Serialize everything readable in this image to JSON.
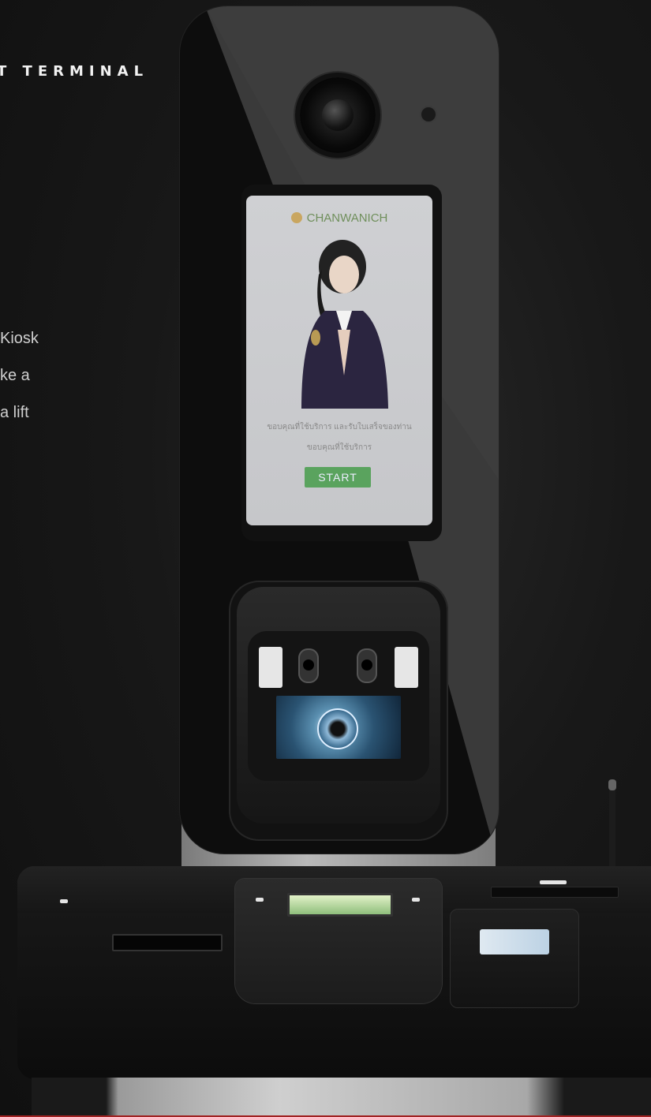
{
  "heading": "T TERMINAL",
  "description_lines": [
    "Kiosk",
    "ke a",
    "a lift"
  ],
  "kiosk_screen": {
    "brand": "CHANWANICH",
    "line1": "ขอบคุณที่ใช้บริการ และรับใบเสร็จของท่าน",
    "line2": "ขอบคุณที่ใช้บริการ",
    "start_label": "START"
  },
  "colors": {
    "background": "#151515",
    "start_button": "#5aa35e",
    "brand_text": "#6f8f5b"
  }
}
